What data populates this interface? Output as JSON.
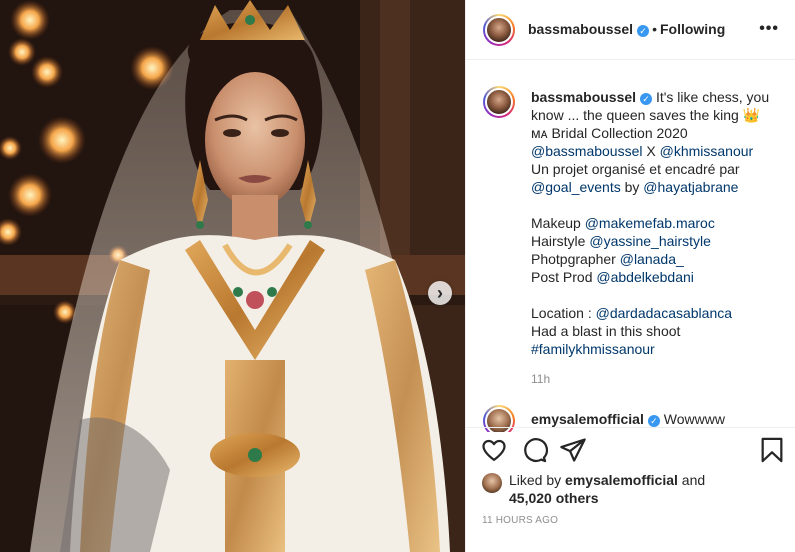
{
  "post": {
    "author": "bassmaboussel",
    "separator": "•",
    "following_label": "Following",
    "more_label": "•••",
    "carousel_next_glyph": "›"
  },
  "caption": {
    "lines": [
      {
        "parts": [
          {
            "t": "It's like chess, you",
            "link": false
          }
        ]
      },
      {
        "parts": [
          {
            "t": "know ... the queen saves the king 👑",
            "link": false
          }
        ]
      },
      {
        "parts": [
          {
            "t": "ᴍᴀ Bridal Collection 2020",
            "link": false
          }
        ]
      },
      {
        "parts": [
          {
            "t": "@bassmaboussel",
            "link": true
          },
          {
            "t": " X ",
            "link": false
          },
          {
            "t": "@khmissanour",
            "link": true
          }
        ]
      },
      {
        "parts": [
          {
            "t": "Un projet organisé et encadré par",
            "link": false
          }
        ]
      },
      {
        "parts": [
          {
            "t": "@goal_events",
            "link": true
          },
          {
            "t": " by ",
            "link": false
          },
          {
            "t": "@hayatjabrane",
            "link": true
          }
        ]
      },
      {
        "parts": []
      },
      {
        "parts": [
          {
            "t": "Makeup ",
            "link": false
          },
          {
            "t": "@makemefab.maroc",
            "link": true
          }
        ]
      },
      {
        "parts": [
          {
            "t": "Hairstyle ",
            "link": false
          },
          {
            "t": "@yassine_hairstyle",
            "link": true
          }
        ]
      },
      {
        "parts": [
          {
            "t": "Photpgrapher ",
            "link": false
          },
          {
            "t": "@lanada_",
            "link": true
          }
        ]
      },
      {
        "parts": [
          {
            "t": "Post Prod ",
            "link": false
          },
          {
            "t": "@abdelkebdani",
            "link": true
          }
        ]
      },
      {
        "parts": []
      },
      {
        "parts": [
          {
            "t": "Location : ",
            "link": false
          },
          {
            "t": "@dardadacasablanca",
            "link": true
          }
        ]
      },
      {
        "parts": [
          {
            "t": "Had a blast in this shoot",
            "link": false
          }
        ]
      },
      {
        "parts": [
          {
            "t": "#familykhmissanour",
            "link": true
          }
        ]
      }
    ],
    "time_ago": "11h"
  },
  "comment_preview": {
    "author": "emysalemofficial",
    "text": "Wowwww"
  },
  "likes": {
    "prefix": "Liked by ",
    "user": "emysalemofficial",
    "middle": " and",
    "count": "45,020 others"
  },
  "timestamp": "11 HOURS AGO",
  "icons": {
    "heart": "heart-icon",
    "comment": "comment-icon",
    "share": "share-icon",
    "save": "bookmark-icon",
    "verified": "verified-badge-icon",
    "next": "chevron-right-icon"
  },
  "colors": {
    "link": "#00376b",
    "verified": "#3897f0",
    "muted": "#8e8e8e",
    "border": "#efefef",
    "gown_gold": "#c98a3e",
    "gown_white": "#f4efe6"
  }
}
